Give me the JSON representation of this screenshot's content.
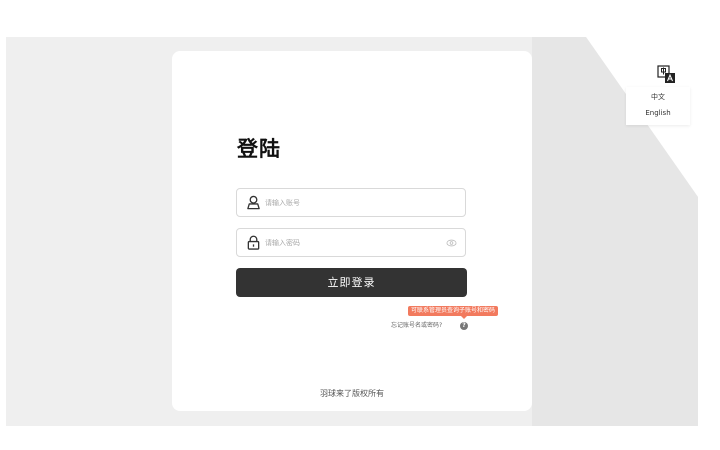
{
  "login": {
    "title": "登陆",
    "username_placeholder": "请输入账号",
    "password_placeholder": "请输入密码",
    "submit_label": "立即登录",
    "tooltip": "可联系管理员查询子账号和密码",
    "forgot_label": "忘记账号名或密码?",
    "help_glyph": "?",
    "copyright": "羽球来了版权所有"
  },
  "language": {
    "options": [
      "中文",
      "English"
    ]
  },
  "colors": {
    "background": "#efefef",
    "card": "#ffffff",
    "button": "#333333",
    "tooltip": "#f27a5e"
  },
  "icons": {
    "username": "user-icon",
    "password": "lock-icon",
    "toggle_password": "eye-icon",
    "language": "translate-icon",
    "help": "help-icon"
  }
}
